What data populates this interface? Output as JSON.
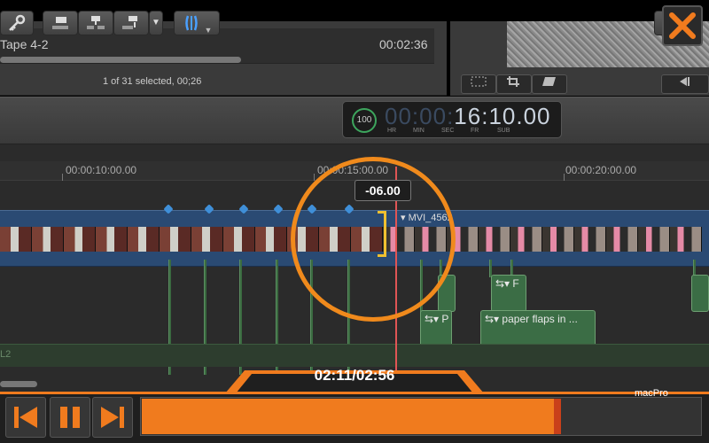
{
  "browser": {
    "clip_name": "Tape 4-2",
    "clip_duration": "00:02:36",
    "status": "1 of 31 selected, 00;26"
  },
  "timecode": {
    "percent": "100",
    "percent_unit": "%",
    "dim_digits": "00:00:",
    "lit_digits": "16:10.00",
    "labels": [
      "HR",
      "MIN",
      "SEC",
      "FR",
      "SUB"
    ]
  },
  "ruler": {
    "labels": [
      "00:00:10:00.00",
      "00:00:15:00.00",
      "00:00:20:00.00"
    ]
  },
  "timeline": {
    "trim_popup": "-06.00",
    "primary_clip": "MVI_4562",
    "connected_clips": [
      "F",
      "P",
      "paper flaps in ..."
    ],
    "audio_lane_label": "L2"
  },
  "player": {
    "time": "02:11/02:56",
    "progress_fraction": 0.75,
    "watermark": "macPro"
  },
  "colors": {
    "accent": "#f07b1e",
    "primary_storyline": "#2a4a73",
    "connected_clip": "#3b6d45",
    "playhead": "#e05555",
    "trim_handle": "#f0c030"
  },
  "icons": [
    "key-icon",
    "connect-clip-icon",
    "insert-clip-icon",
    "append-clip-icon",
    "blade-tool-icon",
    "magic-wand-icon",
    "skip-back-icon",
    "pause-icon",
    "skip-forward-icon",
    "close-icon"
  ]
}
